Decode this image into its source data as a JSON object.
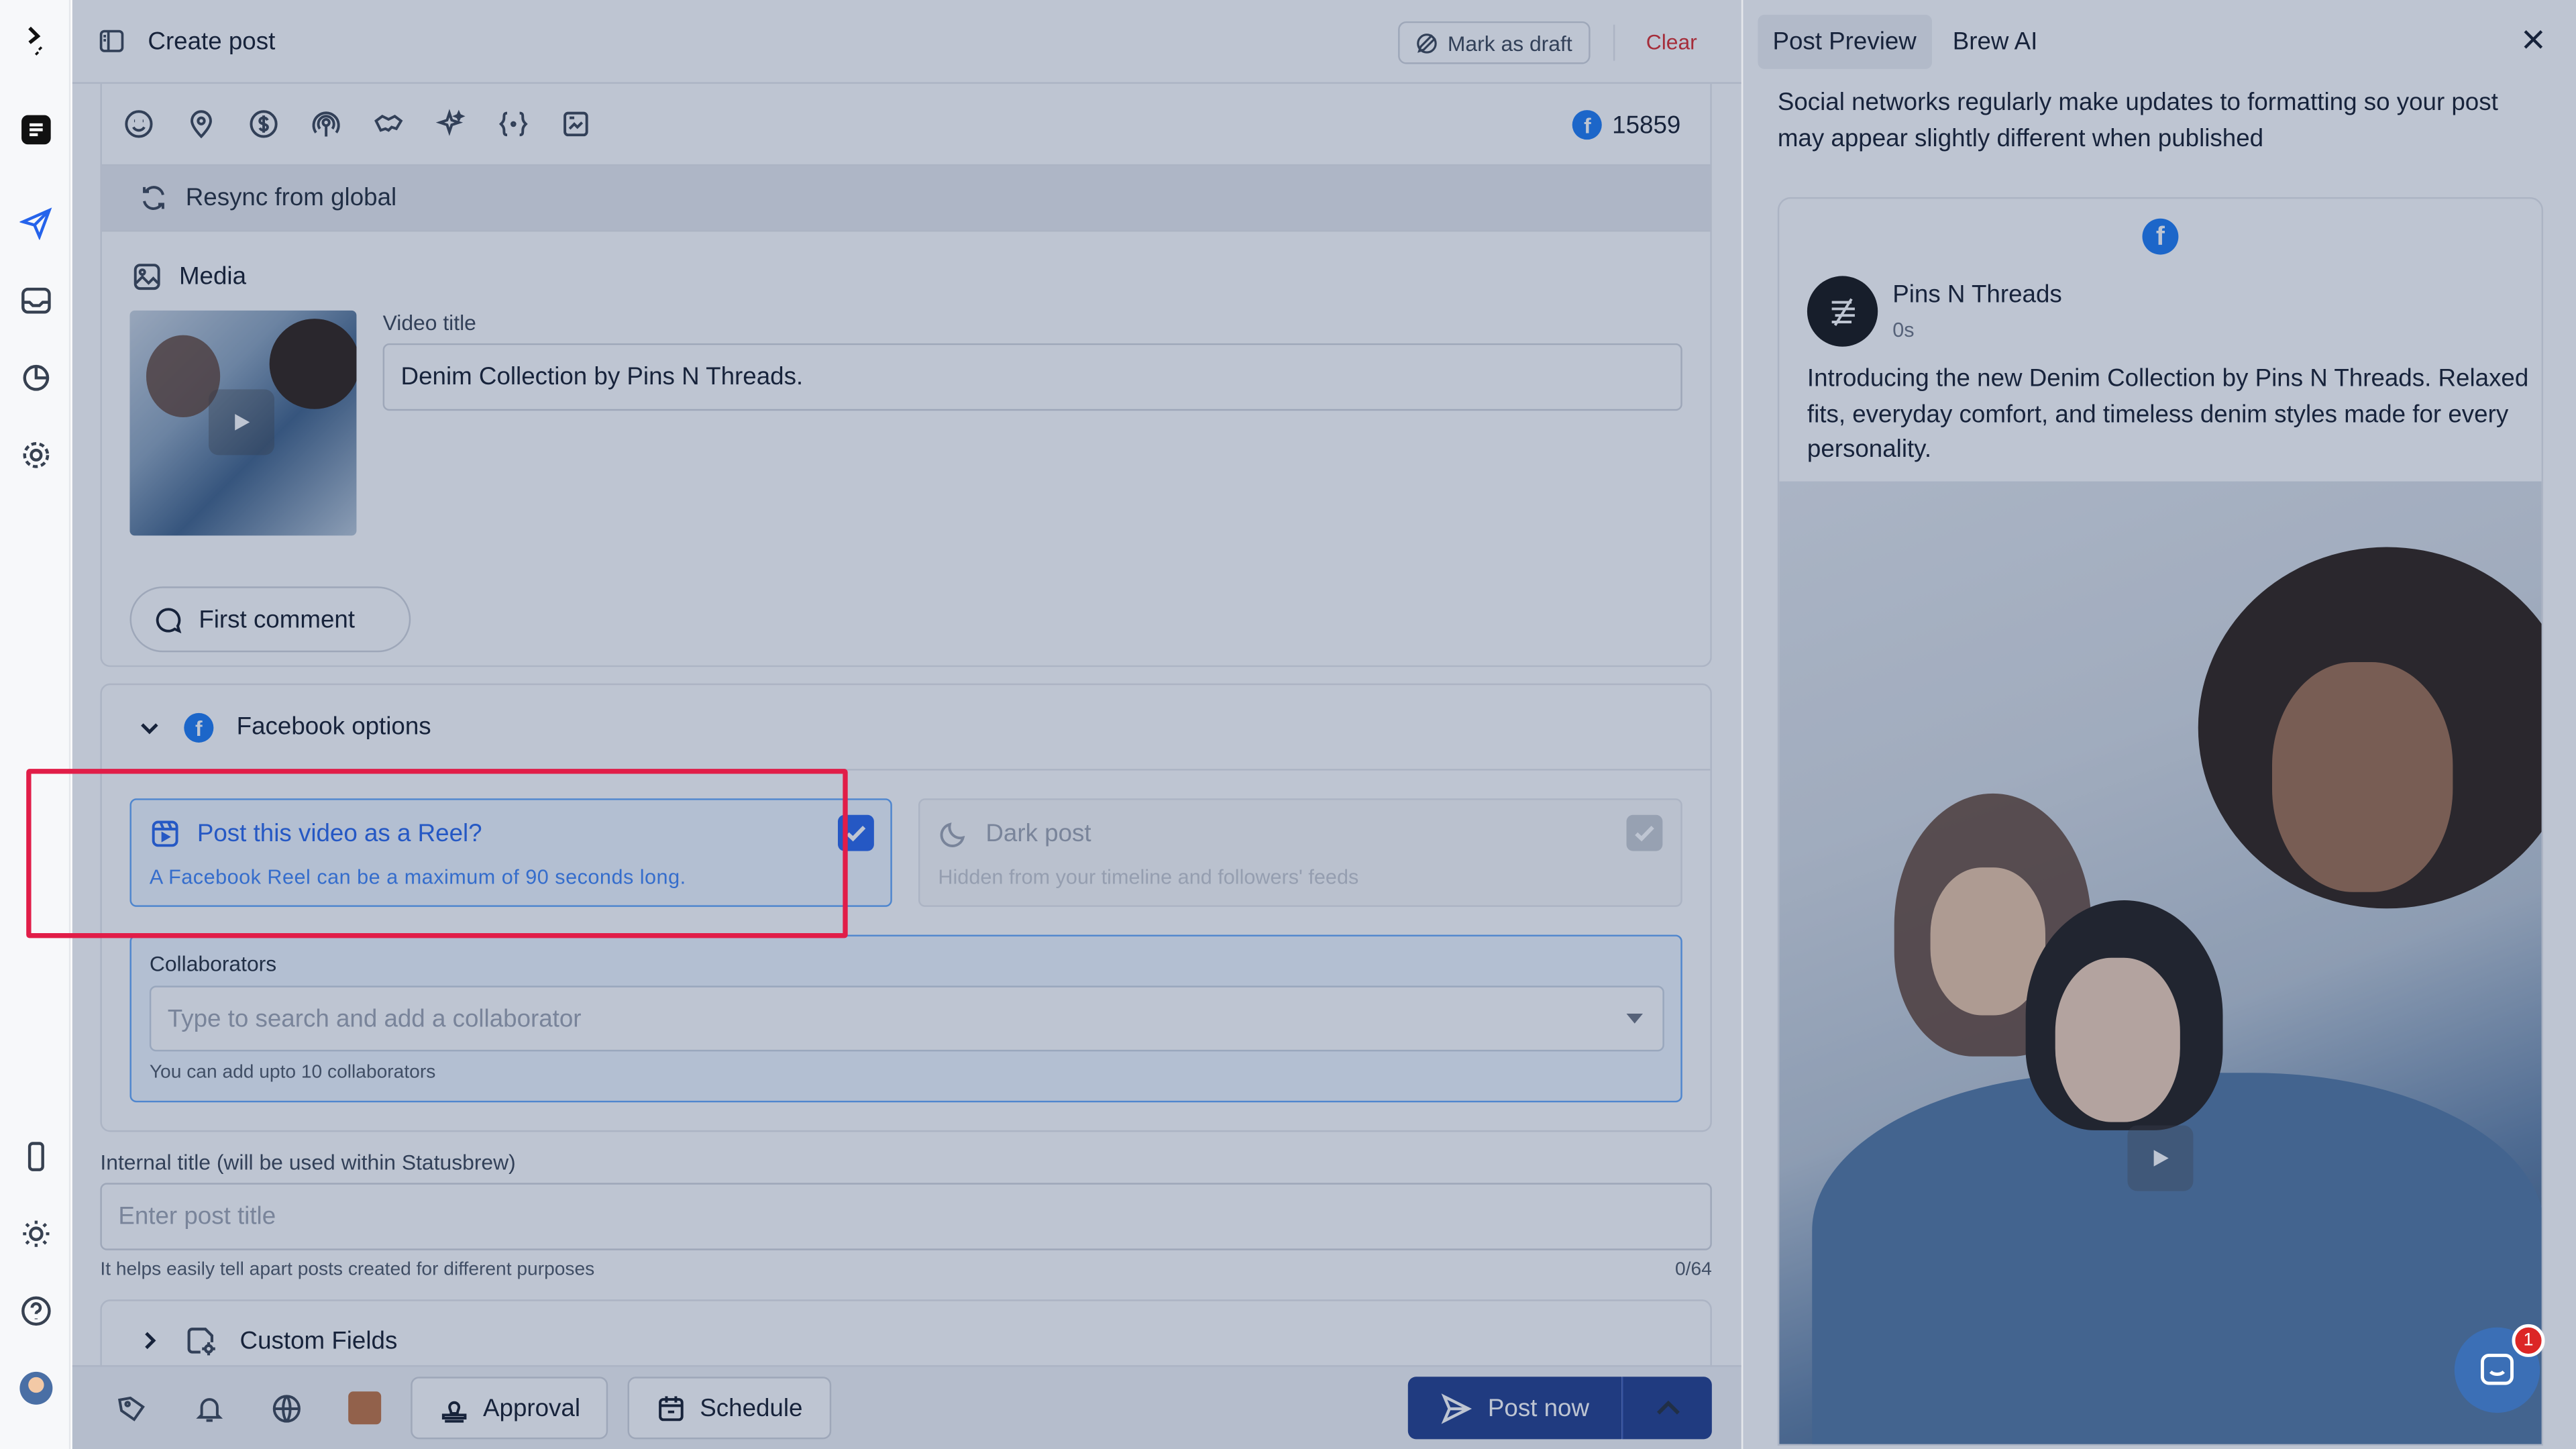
{
  "header": {
    "title": "Create post",
    "mark_draft": "Mark as draft",
    "clear": "Clear"
  },
  "toolbar": {
    "char_count": "15859"
  },
  "resync": {
    "label": "Resync from global"
  },
  "media": {
    "label": "Media",
    "video_title_label": "Video title",
    "video_title_value": "Denim Collection by Pins N Threads."
  },
  "first_comment": {
    "label": "First comment"
  },
  "facebook_options": {
    "label": "Facebook options",
    "reel": {
      "title": "Post this video as a Reel?",
      "desc": "A Facebook Reel can be a maximum of 90 seconds long.",
      "checked": true
    },
    "dark_post": {
      "title": "Dark post",
      "desc": "Hidden from your timeline and followers' feeds",
      "checked": true
    },
    "collaborators": {
      "label": "Collaborators",
      "placeholder": "Type to search and add a collaborator",
      "hint": "You can add upto 10 collaborators"
    }
  },
  "internal_title": {
    "label": "Internal title (will be used within Statusbrew)",
    "placeholder": "Enter post title",
    "hint": "It helps easily tell apart posts created for different purposes",
    "count": "0/64"
  },
  "custom_fields": {
    "label": "Custom Fields"
  },
  "footer": {
    "approval": "Approval",
    "schedule": "Schedule",
    "post_now": "Post now",
    "color": "#c0703e"
  },
  "preview": {
    "tabs": [
      "Post Preview",
      "Brew AI"
    ],
    "note": "Social networks regularly make updates to formatting so your post may appear slightly different when published",
    "page_name": "Pins N Threads",
    "time": "0s",
    "text": "Introducing the new Denim Collection by Pins N Threads. Relaxed fits, everyday comfort, and timeless denim styles made for every personality."
  },
  "chat": {
    "badge": "1"
  },
  "colors": {
    "accent": "#2563eb",
    "highlight": "#e11d48",
    "facebook": "#1877f2",
    "primary_button": "#1e3a8a"
  }
}
